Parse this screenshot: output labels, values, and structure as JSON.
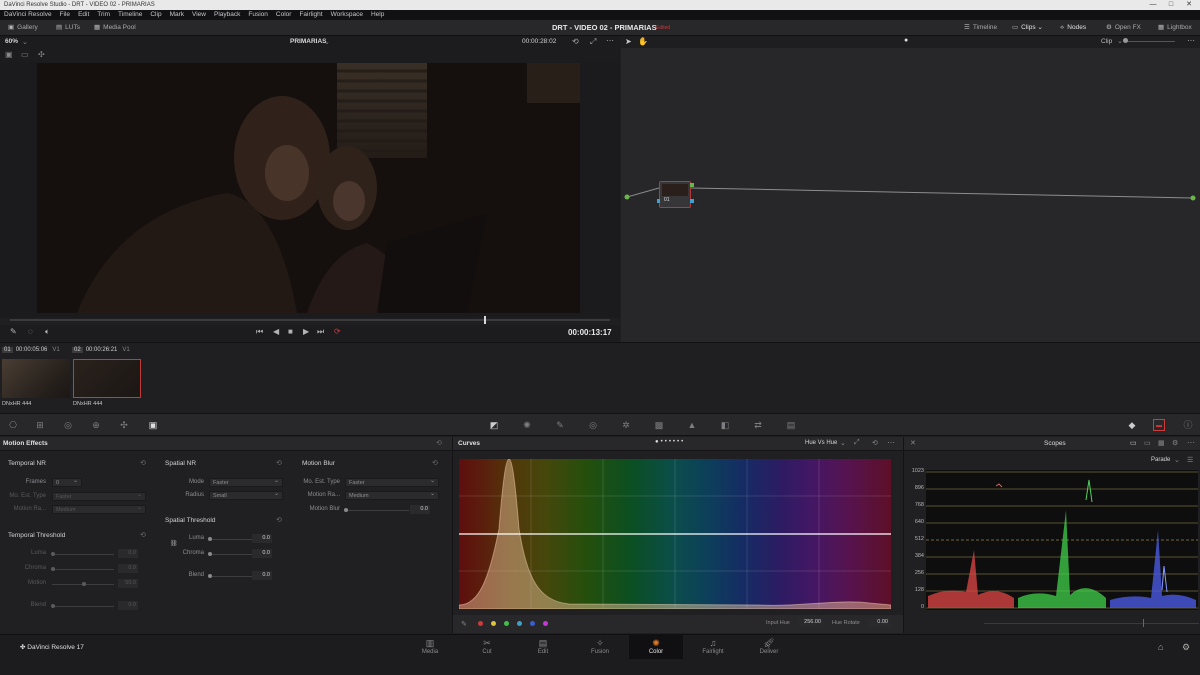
{
  "window": {
    "title": "DaVinci Resolve Studio - DRT - VIDEO 02 - PRIMARIAS"
  },
  "menu": [
    "DaVinci Resolve",
    "File",
    "Edit",
    "Trim",
    "Timeline",
    "Clip",
    "Mark",
    "View",
    "Playback",
    "Fusion",
    "Color",
    "Fairlight",
    "Workspace",
    "Help"
  ],
  "toolbar": {
    "left": [
      "Gallery",
      "LUTs",
      "Media Pool"
    ],
    "project_title": "DRT - VIDEO 02 - PRIMARIAS",
    "edited": "Edited",
    "right": [
      "Timeline",
      "Clips",
      "Nodes",
      "Open FX",
      "Lightbox"
    ]
  },
  "viewer": {
    "zoom": "60%",
    "name": "PRIMARIAS",
    "timecode": "00:00:28:02",
    "current_timecode": "00:00:13:17",
    "playhead_fraction": 0.79
  },
  "node_editor": {
    "mode": "Clip",
    "node_label": "01"
  },
  "clips": [
    {
      "number": "01",
      "timecode": "00:00:05:06",
      "track": "V1",
      "codec": "DNxHR 444",
      "selected": false
    },
    {
      "number": "02",
      "timecode": "00:00:26:21",
      "track": "V1",
      "codec": "DNxHR 444",
      "selected": true
    }
  ],
  "motion_effects": {
    "title": "Motion Effects",
    "temporal_nr": {
      "title": "Temporal NR",
      "frames_label": "Frames",
      "frames_value": "0",
      "mo_est_label": "Mo. Est. Type",
      "mo_est_value": "Faster",
      "motion_range_label": "Motion Ra...",
      "motion_range_value": "Medium"
    },
    "temporal_threshold": {
      "title": "Temporal Threshold",
      "luma_label": "Luma",
      "luma_value": "0.0",
      "chroma_label": "Chroma",
      "chroma_value": "0.0",
      "motion_label": "Motion",
      "motion_value": "50.0",
      "blend_label": "Blend",
      "blend_value": "0.0"
    },
    "spatial_nr": {
      "title": "Spatial NR",
      "mode_label": "Mode",
      "mode_value": "Faster",
      "radius_label": "Radius",
      "radius_value": "Small"
    },
    "spatial_threshold": {
      "title": "Spatial Threshold",
      "luma_label": "Luma",
      "luma_value": "0.0",
      "chroma_label": "Chroma",
      "chroma_value": "0.0",
      "blend_label": "Blend",
      "blend_value": "0.0"
    },
    "motion_blur": {
      "title": "Motion Blur",
      "mo_est_label": "Mo. Est. Type",
      "mo_est_value": "Faster",
      "motion_range_label": "Motion Ra...",
      "motion_range_value": "Medium",
      "blur_label": "Motion Blur",
      "blur_value": "0.0"
    }
  },
  "curves": {
    "title": "Curves",
    "mode": "Hue Vs Hue",
    "input_hue_label": "Input Hue",
    "input_hue_value": "256.00",
    "hue_rotate_label": "Hue Rotate",
    "hue_rotate_value": "0.00",
    "swatches": [
      "#d23a3a",
      "#d8c43a",
      "#3fbf4a",
      "#3fa0c8",
      "#3a5fd2",
      "#c23ad2"
    ]
  },
  "scopes": {
    "title": "Scopes",
    "mode": "Parade",
    "scale": [
      "1023",
      "896",
      "768",
      "640",
      "512",
      "384",
      "256",
      "128",
      "0"
    ]
  },
  "pages": [
    {
      "label": "Media",
      "icon": "media-icon"
    },
    {
      "label": "Cut",
      "icon": "cut-icon"
    },
    {
      "label": "Edit",
      "icon": "edit-icon"
    },
    {
      "label": "Fusion",
      "icon": "fusion-icon"
    },
    {
      "label": "Color",
      "icon": "color-icon",
      "active": true
    },
    {
      "label": "Fairlight",
      "icon": "fairlight-icon"
    },
    {
      "label": "Deliver",
      "icon": "deliver-icon"
    }
  ],
  "brand": "DaVinci Resolve 17",
  "colors": {
    "accent": "#e07a2a",
    "selection": "#c23b3b"
  }
}
